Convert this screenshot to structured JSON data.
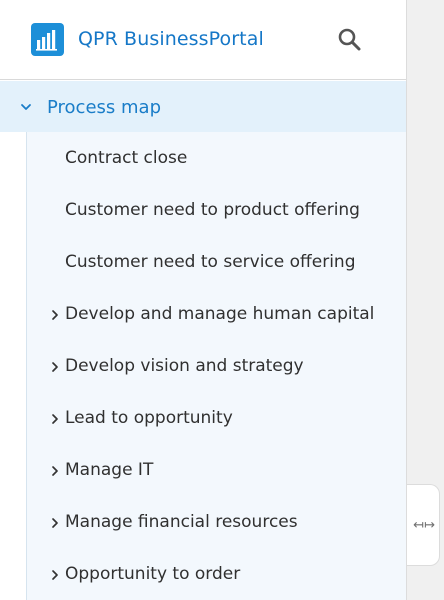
{
  "header": {
    "brand": "QPR BusinessPortal",
    "logo_icon": "bar-chart-icon",
    "search_icon": "search-icon"
  },
  "tree": {
    "root": {
      "label": "Process map",
      "expanded": true
    },
    "items": [
      {
        "label": "Contract close",
        "has_children": false
      },
      {
        "label": "Customer need to product offering",
        "has_children": false
      },
      {
        "label": "Customer need to service offering",
        "has_children": false
      },
      {
        "label": "Develop and manage human capital",
        "has_children": true
      },
      {
        "label": "Develop vision and strategy",
        "has_children": true
      },
      {
        "label": "Lead to opportunity",
        "has_children": true
      },
      {
        "label": "Manage IT",
        "has_children": true
      },
      {
        "label": "Manage financial resources",
        "has_children": true
      },
      {
        "label": "Opportunity to order",
        "has_children": true
      }
    ]
  },
  "resize_handle": {
    "icon": "resize-horizontal-icon",
    "glyph": "↤↦"
  },
  "colors": {
    "accent": "#1577c7",
    "logo": "#1d8fd8",
    "selected_bg": "#e3f1fb",
    "children_bg": "#f3f8fd"
  }
}
